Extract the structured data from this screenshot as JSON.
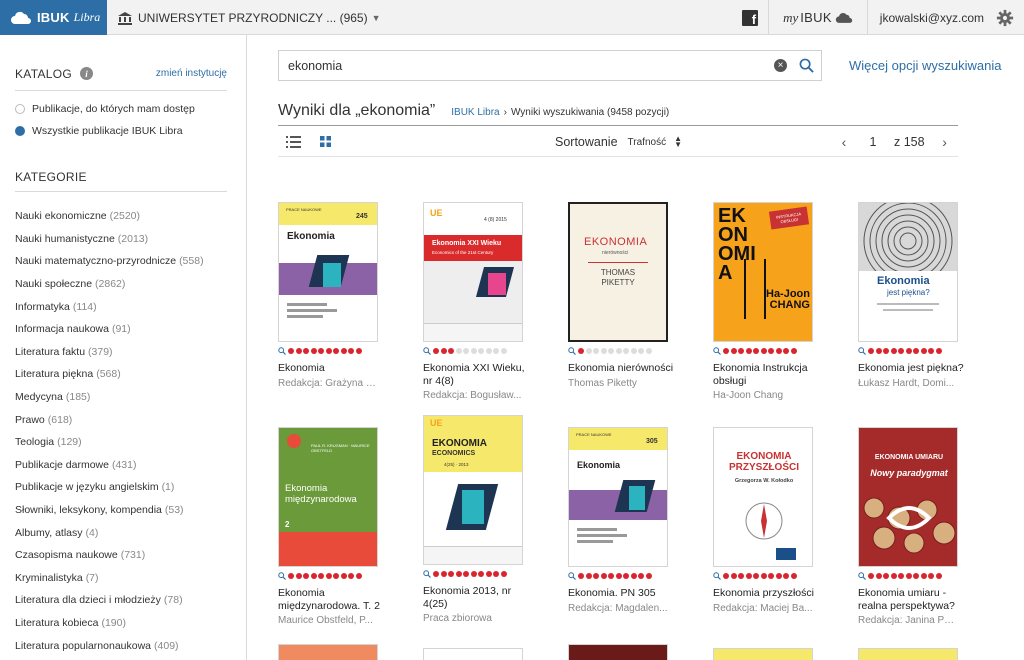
{
  "topbar": {
    "brand": "IBUK",
    "brand_suffix": "Libra",
    "institution": "UNIWERSYTET PRZYRODNICZY ... (965)",
    "facebook_glyph": "f",
    "my_prefix": "my",
    "my_ibuk": "IBUK",
    "user_email": "jkowalski@xyz.com"
  },
  "sidebar": {
    "catalog_title": "KATALOG",
    "info_glyph": "i",
    "change_link": "zmień instytucję",
    "options": [
      {
        "label": "Publikacje, do których mam dostęp",
        "selected": false
      },
      {
        "label": "Wszystkie publikacje IBUK Libra",
        "selected": true
      }
    ],
    "categories_title": "KATEGORIE",
    "categories": [
      {
        "name": "Nauki ekonomiczne",
        "count": "(2520)"
      },
      {
        "name": "Nauki humanistyczne",
        "count": "(2013)"
      },
      {
        "name": "Nauki matematyczno-przyrodnicze",
        "count": "(558)"
      },
      {
        "name": "Nauki społeczne",
        "count": "(2862)"
      },
      {
        "name": "Informatyka",
        "count": "(114)"
      },
      {
        "name": "Informacja naukowa",
        "count": "(91)"
      },
      {
        "name": "Literatura faktu",
        "count": "(379)"
      },
      {
        "name": "Literatura piękna",
        "count": "(568)"
      },
      {
        "name": "Medycyna",
        "count": "(185)"
      },
      {
        "name": "Prawo",
        "count": "(618)"
      },
      {
        "name": "Teologia",
        "count": "(129)"
      },
      {
        "name": "Publikacje darmowe",
        "count": "(431)"
      },
      {
        "name": "Publikacje w języku angielskim",
        "count": "(1)"
      },
      {
        "name": "Słowniki, leksykony, kompendia",
        "count": "(53)"
      },
      {
        "name": "Albumy, atlasy",
        "count": "(4)"
      },
      {
        "name": "Czasopisma naukowe",
        "count": "(731)"
      },
      {
        "name": "Kryminalistyka",
        "count": "(7)"
      },
      {
        "name": "Literatura dla dzieci i młodzieży",
        "count": "(78)"
      },
      {
        "name": "Literatura kobieca",
        "count": "(190)"
      },
      {
        "name": "Literatura popularnonaukowa",
        "count": "(409)"
      }
    ]
  },
  "search": {
    "value": "ekonomia",
    "clear_glyph": "×",
    "more_options": "Więcej opcji wyszukiwania"
  },
  "results": {
    "title": "Wyniki dla „ekonomia”",
    "crumb_home": "IBUK Libra",
    "crumb_sep": "›",
    "crumb_current": "Wyniki wyszukiwania (9458  pozycji)",
    "sort_label": "Sortowanie",
    "sort_value": "Trafność",
    "sort_updown": [
      "▲",
      "▼"
    ],
    "page": "1",
    "of_pages": "z 158",
    "prev": "‹",
    "next": "›"
  },
  "books": [
    {
      "title": "Ekonomia",
      "author": "Redakcja: Grażyna W...",
      "dots_on": 10,
      "cover": {
        "title": "Ekonomia",
        "num": "245",
        "header": "PRACE NAUKOWE"
      }
    },
    {
      "title": "Ekonomia XXI Wieku, nr 4(8)",
      "author": "Redakcja: Bogusław...",
      "dots_on": 3,
      "cover": {
        "title": "Ekonomia XXI Wieku",
        "subtitle": "Economics of the 21st Century",
        "num": "4 (8) 2015"
      }
    },
    {
      "title": "Ekonomia nierówności",
      "author": "Thomas Piketty",
      "dots_on": 1,
      "cover": {
        "title": "EKONOMIA",
        "subtitle": "nierówności",
        "author": "THOMAS PIKETTY"
      }
    },
    {
      "title": "Ekonomia Instrukcja obsługi",
      "author": "Ha-Joon Chang",
      "dots_on": 10,
      "cover": {
        "title": "EKONOMIA",
        "badge": "INSTRUKCJA OBSŁUGI",
        "author": "Ha-Joon CHANG"
      }
    },
    {
      "title": "Ekonomia jest piękna?",
      "author": "Łukasz Hardt, Domi...",
      "dots_on": 10,
      "cover": {
        "title": "Ekonomia",
        "subtitle": "jest piękna?"
      }
    },
    {
      "title": "Ekonomia międzynarodowa. T. 2",
      "author": "Maurice Obstfeld, P...",
      "dots_on": 10,
      "cover": {
        "title": "Ekonomia międzynarodowa",
        "num": "2",
        "author": "PAUL R. KRUGMAN · MAURICE OBSTFELD"
      }
    },
    {
      "title": "Ekonomia 2013, nr 4(25)",
      "author": "Praca zbiorowa",
      "dots_on": 10,
      "cover": {
        "title": "EKONOMIA",
        "subtitle": "ECONOMICS",
        "num": "4(25) · 2013"
      }
    },
    {
      "title": "Ekonomia. PN 305",
      "author": "Redakcja: Magdalen...",
      "dots_on": 10,
      "cover": {
        "title": "Ekonomia",
        "num": "305",
        "header": "PRACE NAUKOWE"
      }
    },
    {
      "title": "Ekonomia przyszłości",
      "author": "Redakcja: Maciej Ba...",
      "dots_on": 10,
      "cover": {
        "title": "EKONOMIA PRZYSZŁOŚCI",
        "author": "Grzegorza W. Kołodko"
      }
    },
    {
      "title": "Ekonomia umiaru - realna perspektywa?",
      "author": "Redakcja: Janina Pac...",
      "dots_on": 10,
      "cover": {
        "title": "EKONOMIA UMIARU",
        "subtitle": "Nowy paradygmat"
      }
    }
  ],
  "colors": {
    "brand_blue": "#2e6ea6",
    "dot_red": "#d9262e",
    "yellow": "#f6e86b",
    "purple": "#8b62a5",
    "red": "#d92b2b",
    "orange": "#f7a21b",
    "green": "#6a9a3a"
  }
}
